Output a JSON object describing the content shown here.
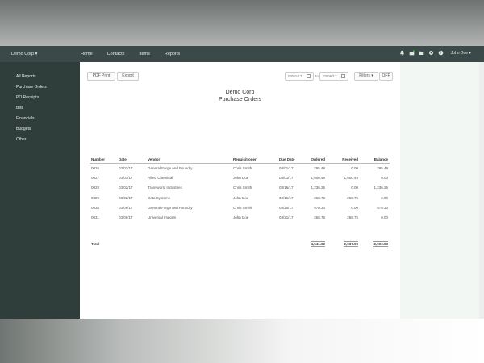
{
  "topbar": {
    "company": "Demo Corp ▾",
    "nav": [
      "Home",
      "Contacts",
      "Items",
      "Reports"
    ],
    "user": "John Doe ▾"
  },
  "sidebar": {
    "items": [
      "All Reports",
      "Purchase Orders",
      "PO Receipts",
      "Bills",
      "Financials",
      "Budgets",
      "Other"
    ]
  },
  "toolbar": {
    "pdf_print": "PDF Print",
    "export": "Export",
    "date_from": "03/01/17",
    "to_label": "to",
    "date_to": "03/06/17",
    "filters": "Filters ▾",
    "off": "OFF"
  },
  "report": {
    "company": "Demo Corp",
    "title": "Purchase Orders",
    "columns": [
      "Number",
      "Date",
      "Vendor",
      "Requisitioner",
      "Due Date",
      "Ordered",
      "Received",
      "Balance"
    ],
    "rows": [
      [
        "0026",
        "03/01/17",
        "General Forge and Foundry",
        "Chris Smith",
        "04/01/17",
        "295.49",
        "0.00",
        "295.49"
      ],
      [
        "0027",
        "03/01/17",
        "Allied Chemical",
        "John Doe",
        "04/01/17",
        "1,500.49",
        "1,500.49",
        "0.00"
      ],
      [
        "0028",
        "03/02/17",
        "Transworld Industries",
        "Chris Smith",
        "03/16/17",
        "1,236.25",
        "0.00",
        "1,236.25"
      ],
      [
        "0029",
        "03/02/17",
        "Data Systems",
        "John Doe",
        "03/16/17",
        "268.75",
        "268.75",
        "0.00"
      ],
      [
        "0030",
        "03/06/17",
        "General Forge and Foundry",
        "Chris Smith",
        "03/20/17",
        "970.30",
        "0.00",
        "970.30"
      ],
      [
        "0031",
        "03/06/17",
        "Universal Imports",
        "John Doe",
        "03/21/17",
        "268.75",
        "268.75",
        "0.00"
      ]
    ],
    "total_label": "Total",
    "totals": [
      "4,541.02",
      "2,037.99",
      "2,503.03"
    ]
  }
}
